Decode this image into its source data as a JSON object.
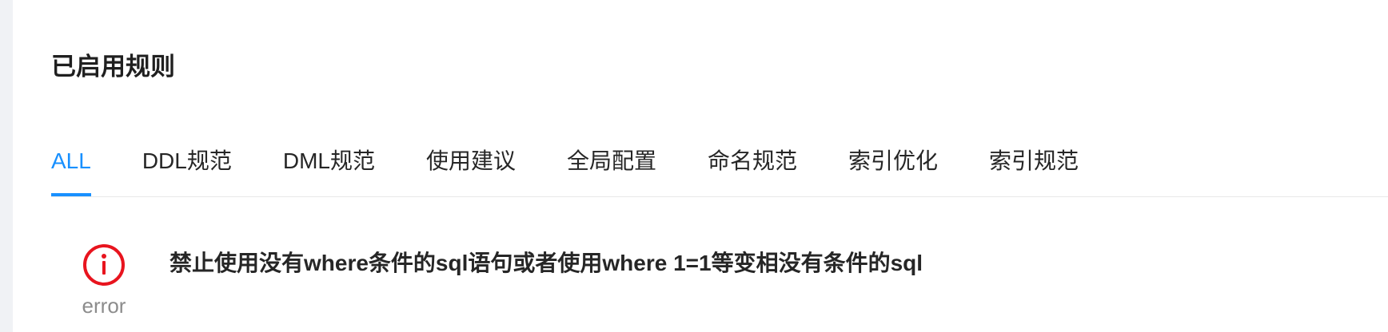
{
  "page": {
    "title": "已启用规则"
  },
  "tabs": [
    {
      "label": "ALL",
      "active": true
    },
    {
      "label": "DDL规范",
      "active": false
    },
    {
      "label": "DML规范",
      "active": false
    },
    {
      "label": "使用建议",
      "active": false
    },
    {
      "label": "全局配置",
      "active": false
    },
    {
      "label": "命名规范",
      "active": false
    },
    {
      "label": "索引优化",
      "active": false
    },
    {
      "label": "索引规范",
      "active": false
    }
  ],
  "rules": [
    {
      "level": "error",
      "icon": "error-circle-icon",
      "description": "禁止使用没有where条件的sql语句或者使用where 1=1等变相没有条件的sql"
    }
  ],
  "colors": {
    "accent": "#1890ff",
    "error": "#e8141e",
    "sidebar_bg": "#f0f2f5"
  }
}
